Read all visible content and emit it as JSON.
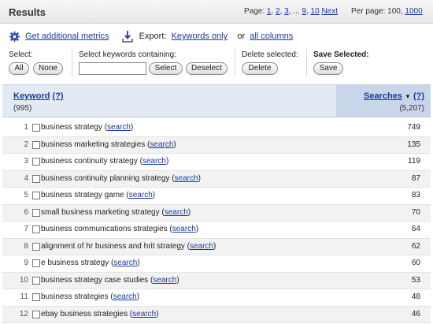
{
  "header": {
    "title": "Results",
    "pager_label": "Page:",
    "pages": [
      "1",
      "2",
      "3",
      "9",
      "10"
    ],
    "ellipsis": "...",
    "next_label": "Next",
    "per_page_label": "Per page:",
    "per_page_current": "100",
    "per_page_option": "1000"
  },
  "metrics": {
    "get_metrics_label": "Get additional metrics",
    "export_label": "Export:",
    "export_keywords_label": "Keywords only",
    "or_label": "or",
    "export_all_label": "all columns"
  },
  "controls": {
    "select_label": "Select:",
    "all_label": "All",
    "none_label": "None",
    "containing_label": "Select keywords containing:",
    "containing_value": "",
    "select_button": "Select",
    "deselect_button": "Deselect",
    "delete_selected_label": "Delete selected:",
    "delete_button": "Delete",
    "save_selected_label": "Save Selected:",
    "save_button": "Save"
  },
  "table": {
    "keyword_header": "Keyword",
    "help_label": "(?)",
    "keyword_count": "(995)",
    "searches_header": "Searches",
    "sort_arrow": "▼",
    "searches_total": "(5,207)",
    "search_link_label": "search",
    "rows": [
      {
        "num": "1",
        "keyword": "business strategy",
        "searches": "749"
      },
      {
        "num": "2",
        "keyword": "business marketing strategies",
        "searches": "135"
      },
      {
        "num": "3",
        "keyword": "business continuity strategy",
        "searches": "119"
      },
      {
        "num": "4",
        "keyword": "business continuity planning strategy",
        "searches": "87"
      },
      {
        "num": "5",
        "keyword": "business strategy game",
        "searches": "83"
      },
      {
        "num": "6",
        "keyword": "small business marketing strategy",
        "searches": "70"
      },
      {
        "num": "7",
        "keyword": "business communications strategies",
        "searches": "64"
      },
      {
        "num": "8",
        "keyword": "alignment of hr business and hrit strategy",
        "searches": "62"
      },
      {
        "num": "9",
        "keyword": "e business strategy",
        "searches": "60"
      },
      {
        "num": "10",
        "keyword": "business strategy case studies",
        "searches": "53"
      },
      {
        "num": "11",
        "keyword": "business strategies",
        "searches": "48"
      },
      {
        "num": "12",
        "keyword": "ebay business strategies",
        "searches": "46"
      }
    ]
  }
}
